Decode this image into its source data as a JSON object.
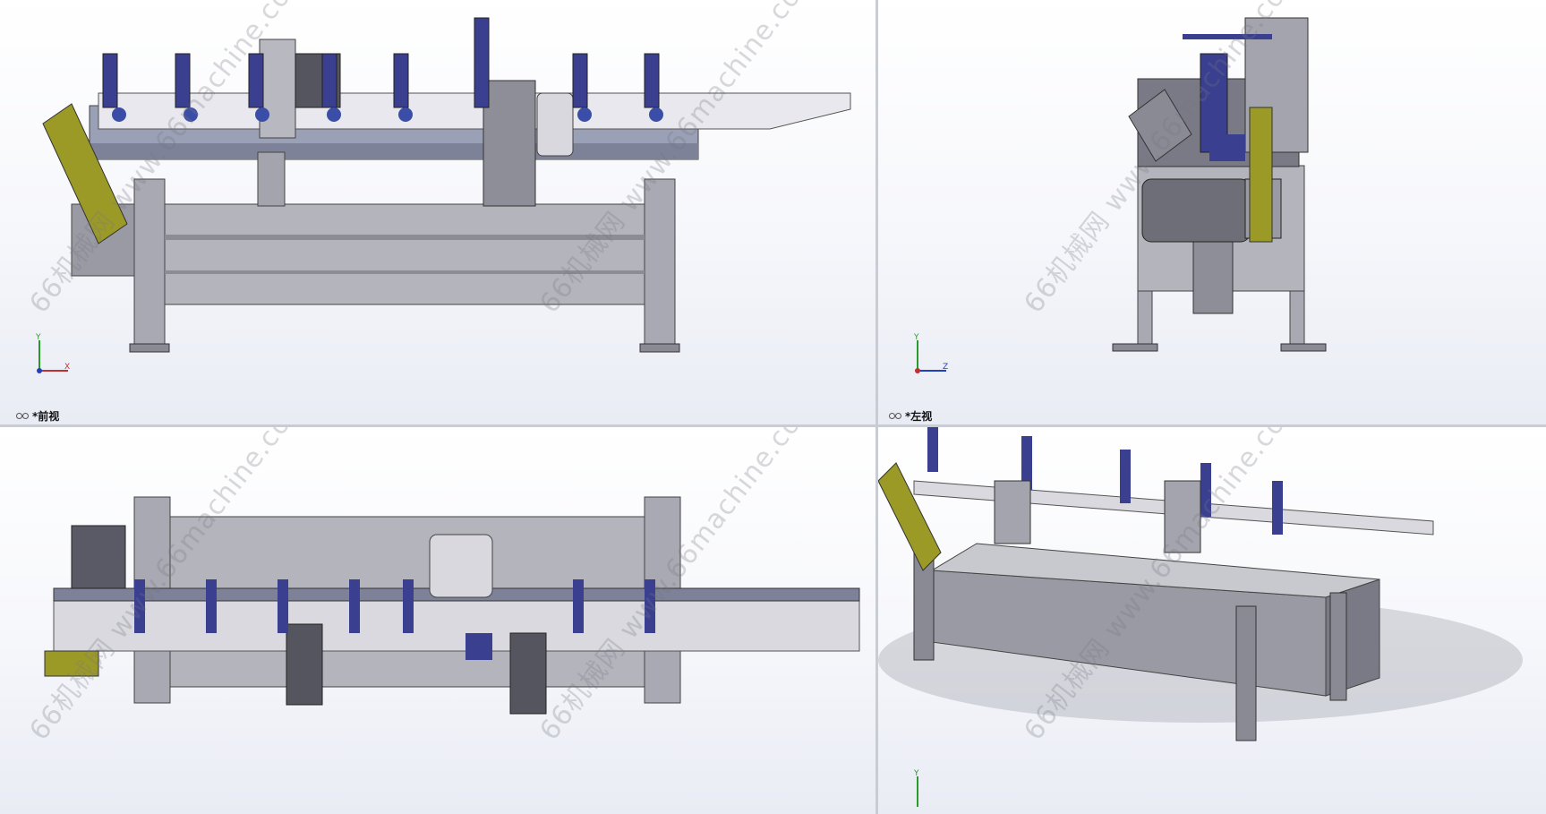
{
  "views": [
    {
      "id": "front",
      "label": "*前视",
      "axis_h": "X",
      "axis_v": "Y"
    },
    {
      "id": "left",
      "label": "*左视",
      "axis_h": "Z",
      "axis_v": "Y"
    },
    {
      "id": "top",
      "label": "",
      "axis_h": "",
      "axis_v": ""
    },
    {
      "id": "iso",
      "label": "",
      "axis_h": "",
      "axis_v": "Y"
    }
  ],
  "watermark": {
    "site": "www.66machine.com",
    "brand": "66机械网"
  },
  "colors": {
    "frame": "#a9a9b3",
    "frame_dark": "#5a5a66",
    "blue": "#3a3f8f",
    "belt": "#9b9a27",
    "rail": "#d9d9df",
    "steel": "#c8c8cf"
  },
  "icons": {
    "view_icon": "glasses-icon",
    "triad": "coordinate-triad-icon"
  }
}
